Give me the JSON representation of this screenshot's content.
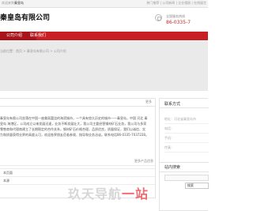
{
  "topbar": {
    "left_text": "欢迎来到",
    "left_link": "秦皇岛",
    "right_text": "热门推荐 | 公司新闻 | 企业相册 | 在线留言"
  },
  "header": {
    "company_name": "秦皇岛有限公司",
    "phone_label": "全国服务热线",
    "phone_number": "86-0335-7"
  },
  "nav": {
    "items": [
      "公司介绍",
      "联系我们"
    ]
  },
  "breadcrumb": {
    "text": "当前位置：首页 > 秦皇岛有限公司 > 公司介绍"
  },
  "company_intro": {
    "more_label": "更多",
    "lines": [
      "秦皇岛有限公司坐落在中国一座美丽富饶的海滨城市，一个具有悠久历史的城市——秦皇岛，中国 河北 秦",
      "皇岛 海港区，公司成立以来发展迅速，业务不断发展壮大，我公司主要经营钢材矿石业务，我公司与多家",
      "零售商和代理商建立了长期稳定的合作关系，钢材矿石价格合理，品质优良，质量保证，我们以诚信、实",
      "力和质量获得业界的高度认可，欢迎各界朋友莅临参观、指导和业务洽谈。联系电话86-0335-7037228。"
    ],
    "read_more": "更多产品信息"
  },
  "tabs": {
    "items": [
      "本页面",
      "本源"
    ]
  },
  "sidebar": {
    "contact_title": "联系方式",
    "contact_lines": [
      "地址：河北省秦皇岛市",
      "电话：",
      "手机：",
      "传真："
    ],
    "search_title": "站内搜索",
    "search_select": "搜索"
  },
  "watermark": {
    "text": "玖天导航",
    "accent": "一站"
  }
}
